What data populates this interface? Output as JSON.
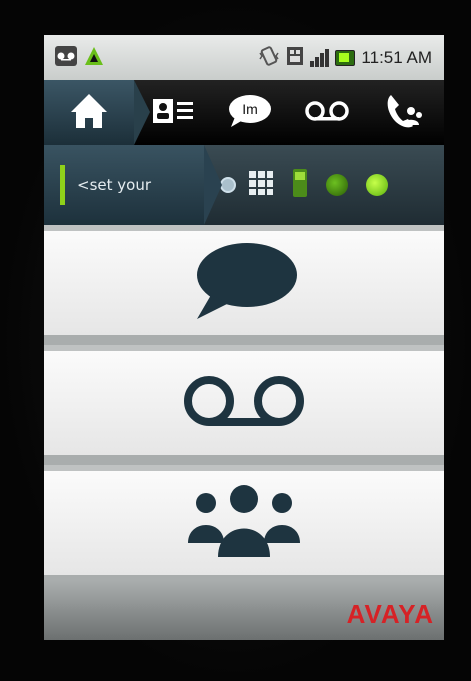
{
  "status_bar": {
    "time": "11:51 AM",
    "icons": [
      "voicemail-tape-icon",
      "warning-triangle-icon",
      "phone-vibrate-icon",
      "sim-icon",
      "signal-bars-icon",
      "battery-icon"
    ]
  },
  "tabs": [
    {
      "name": "home",
      "icon": "home-icon"
    },
    {
      "name": "contacts",
      "icon": "contact-card-icon"
    },
    {
      "name": "im",
      "icon": "chat-bubble-icon",
      "label": "Im"
    },
    {
      "name": "voicemail",
      "icon": "voicemail-icon"
    },
    {
      "name": "conference",
      "icon": "phone-group-icon"
    }
  ],
  "presence": {
    "status_text": "<set your",
    "icons": [
      "keypad-icon",
      "phone-device-icon",
      "status-dot-icon",
      "status-dot-bright-icon"
    ]
  },
  "list_items": [
    {
      "name": "messages",
      "icon": "speech-bubble-icon"
    },
    {
      "name": "voicemail",
      "icon": "voicemail-icon"
    },
    {
      "name": "contacts-groups",
      "icon": "people-group-icon"
    }
  ],
  "brand": {
    "logo": "AVAYA",
    "color": "#d62226"
  }
}
